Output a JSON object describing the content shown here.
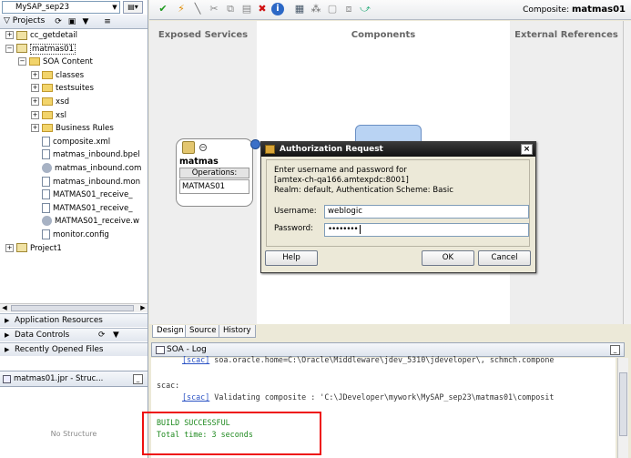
{
  "left_panel": {
    "app_selector": "MySAP_sep23",
    "projects_label": "Projects",
    "tree": [
      {
        "label": "cc_getdetail",
        "kind": "proj",
        "expander": "+",
        "indent": 0
      },
      {
        "label": "matmas01",
        "kind": "proj",
        "expander": "−",
        "indent": 0,
        "selected": true
      },
      {
        "label": "SOA Content",
        "kind": "folder",
        "expander": "−",
        "indent": 1
      },
      {
        "label": "classes",
        "kind": "folder",
        "expander": "+",
        "indent": 2
      },
      {
        "label": "testsuites",
        "kind": "folder",
        "expander": "+",
        "indent": 2
      },
      {
        "label": "xsd",
        "kind": "folder",
        "expander": "+",
        "indent": 2
      },
      {
        "label": "xsl",
        "kind": "folder",
        "expander": "+",
        "indent": 2
      },
      {
        "label": "Business Rules",
        "kind": "folder",
        "expander": "+",
        "indent": 2
      },
      {
        "label": "composite.xml",
        "kind": "file",
        "indent": 2
      },
      {
        "label": "matmas_inbound.bpel",
        "kind": "file",
        "indent": 2
      },
      {
        "label": "matmas_inbound.com",
        "kind": "gear",
        "indent": 2
      },
      {
        "label": "matmas_inbound.mon",
        "kind": "file",
        "indent": 2
      },
      {
        "label": "MATMAS01_receive_",
        "kind": "file",
        "indent": 2
      },
      {
        "label": "MATMAS01_receive_",
        "kind": "file",
        "indent": 2
      },
      {
        "label": "MATMAS01_receive.w",
        "kind": "gear",
        "indent": 2
      },
      {
        "label": "monitor.config",
        "kind": "file",
        "indent": 2
      },
      {
        "label": "Project1",
        "kind": "proj",
        "expander": "+",
        "indent": 0
      }
    ],
    "accordions": [
      "Application Resources",
      "Data Controls",
      "Recently Opened Files"
    ],
    "structure_title": "matmas01.jpr - Struc...",
    "no_structure": "No Structure"
  },
  "toolbar": {
    "composite_prefix": "Composite:",
    "composite_name": "matmas01"
  },
  "canvas": {
    "exposed_services": "Exposed Services",
    "components": "Components",
    "external_references": "External References",
    "service": {
      "name": "matmas",
      "operations_label": "Operations:",
      "operation": "MATMAS01"
    }
  },
  "dialog": {
    "title": "Authorization Request",
    "line1": "Enter username and password for",
    "line2": "[amtex-ch-qa166.amtexpdc:8001]",
    "line3": "Realm: default, Authentication Scheme: Basic",
    "username_label": "Username:",
    "username_value": "weblogic",
    "password_label": "Password:",
    "password_value": "••••••••",
    "help": "Help",
    "ok": "OK",
    "cancel": "Cancel",
    "close": "×"
  },
  "tabs": [
    "Design",
    "Source",
    "History"
  ],
  "log": {
    "title": "SOA - Log",
    "line0_bracket": "[scac]",
    "line0_text": " soa.oracle.home=C:\\Oracle\\Middleware\\jdev_5310\\jdeveloper\\, schmch.compone",
    "line1": "scac:",
    "line2_bracket": "[scac]",
    "line2_text": " Validating composite : 'C:\\JDeveloper\\mywork\\MySAP_sep23\\matmas01\\composit",
    "line3": "BUILD SUCCESSFUL",
    "line4": "Total time: 3 seconds"
  },
  "colors": {
    "highlight": "#ee1111",
    "dialog_title_bg": "#1a1a1a",
    "log_success": "#208a20"
  }
}
